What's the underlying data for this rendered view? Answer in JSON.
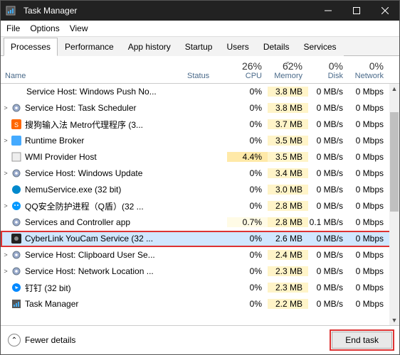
{
  "title": "Task Manager",
  "menu": [
    "File",
    "Options",
    "View"
  ],
  "tabs": [
    "Processes",
    "Performance",
    "App history",
    "Startup",
    "Users",
    "Details",
    "Services"
  ],
  "activeTab": 0,
  "columns": {
    "name": "Name",
    "status": "Status",
    "metrics": [
      {
        "pct": "26%",
        "label": "CPU",
        "sort": false
      },
      {
        "pct": "62%",
        "label": "Memory",
        "sort": true
      },
      {
        "pct": "0%",
        "label": "Disk",
        "sort": false
      },
      {
        "pct": "0%",
        "label": "Network",
        "sort": false
      }
    ]
  },
  "rows": [
    {
      "exp": "",
      "icon": "gear",
      "name": "Service Host: Windows Push No...",
      "cpu": "0%",
      "mem": "3.8 MB",
      "disk": "0 MB/s",
      "net": "0 Mbps",
      "cpuHeat": "",
      "selected": false,
      "highlight": false,
      "child": true
    },
    {
      "exp": ">",
      "icon": "gear",
      "name": "Service Host: Task Scheduler",
      "cpu": "0%",
      "mem": "3.8 MB",
      "disk": "0 MB/s",
      "net": "0 Mbps",
      "cpuHeat": "",
      "selected": false,
      "highlight": false,
      "child": false
    },
    {
      "exp": "",
      "icon": "sogou",
      "name": "搜狗输入法 Metro代理程序 (3...",
      "cpu": "0%",
      "mem": "3.7 MB",
      "disk": "0 MB/s",
      "net": "0 Mbps",
      "cpuHeat": "",
      "selected": false,
      "highlight": false,
      "child": false
    },
    {
      "exp": ">",
      "icon": "rt",
      "name": "Runtime Broker",
      "cpu": "0%",
      "mem": "3.5 MB",
      "disk": "0 MB/s",
      "net": "0 Mbps",
      "cpuHeat": "",
      "selected": false,
      "highlight": false,
      "child": false
    },
    {
      "exp": "",
      "icon": "app",
      "name": "WMI Provider Host",
      "cpu": "4.4%",
      "mem": "3.5 MB",
      "disk": "0 MB/s",
      "net": "0 Mbps",
      "cpuHeat": "med",
      "selected": false,
      "highlight": false,
      "child": false
    },
    {
      "exp": ">",
      "icon": "gear",
      "name": "Service Host: Windows Update",
      "cpu": "0%",
      "mem": "3.4 MB",
      "disk": "0 MB/s",
      "net": "0 Mbps",
      "cpuHeat": "",
      "selected": false,
      "highlight": false,
      "child": false
    },
    {
      "exp": "",
      "icon": "nemu",
      "name": "NemuService.exe (32 bit)",
      "cpu": "0%",
      "mem": "3.0 MB",
      "disk": "0 MB/s",
      "net": "0 Mbps",
      "cpuHeat": "",
      "selected": false,
      "highlight": false,
      "child": false
    },
    {
      "exp": ">",
      "icon": "qq",
      "name": "QQ安全防护进程（Q盾）(32 ...",
      "cpu": "0%",
      "mem": "2.8 MB",
      "disk": "0 MB/s",
      "net": "0 Mbps",
      "cpuHeat": "",
      "selected": false,
      "highlight": false,
      "child": false
    },
    {
      "exp": "",
      "icon": "gear",
      "name": "Services and Controller app",
      "cpu": "0.7%",
      "mem": "2.8 MB",
      "disk": "0.1 MB/s",
      "net": "0 Mbps",
      "cpuHeat": "low",
      "selected": false,
      "highlight": false,
      "child": false
    },
    {
      "exp": "",
      "icon": "youcam",
      "name": "CyberLink YouCam Service (32 ...",
      "cpu": "0%",
      "mem": "2.6 MB",
      "disk": "0 MB/s",
      "net": "0 Mbps",
      "cpuHeat": "",
      "selected": true,
      "highlight": true,
      "child": false
    },
    {
      "exp": ">",
      "icon": "gear",
      "name": "Service Host: Clipboard User Se...",
      "cpu": "0%",
      "mem": "2.4 MB",
      "disk": "0 MB/s",
      "net": "0 Mbps",
      "cpuHeat": "",
      "selected": false,
      "highlight": false,
      "child": false
    },
    {
      "exp": ">",
      "icon": "gear",
      "name": "Service Host: Network Location ...",
      "cpu": "0%",
      "mem": "2.3 MB",
      "disk": "0 MB/s",
      "net": "0 Mbps",
      "cpuHeat": "",
      "selected": false,
      "highlight": false,
      "child": false
    },
    {
      "exp": "",
      "icon": "ding",
      "name": "钉钉 (32 bit)",
      "cpu": "0%",
      "mem": "2.3 MB",
      "disk": "0 MB/s",
      "net": "0 Mbps",
      "cpuHeat": "",
      "selected": false,
      "highlight": false,
      "child": false
    },
    {
      "exp": "",
      "icon": "tm",
      "name": "Task Manager",
      "cpu": "0%",
      "mem": "2.2 MB",
      "disk": "0 MB/s",
      "net": "0 Mbps",
      "cpuHeat": "",
      "selected": false,
      "highlight": false,
      "child": false
    }
  ],
  "footer": {
    "fewer": "Fewer details",
    "end": "End task"
  },
  "endHighlight": true
}
